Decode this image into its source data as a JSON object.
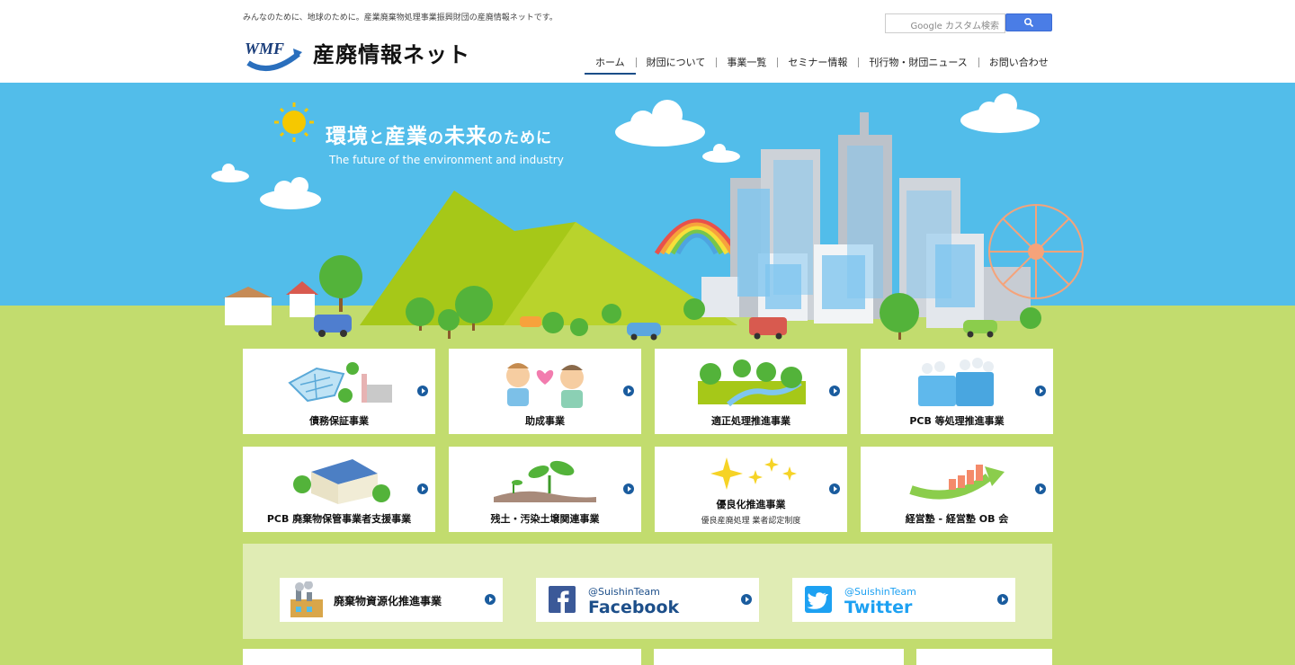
{
  "header": {
    "tagline": "みんなのために、地球のために。産業廃棄物処理事業振興財団の産廃情報ネットです。",
    "logo_mark_text": "WMF",
    "site_name": "産廃情報ネット",
    "search_placeholder": "Google カスタム検索"
  },
  "nav": {
    "items": [
      {
        "label": "ホーム"
      },
      {
        "label": "財団について"
      },
      {
        "label": "事業一覧"
      },
      {
        "label": "セミナー情報"
      },
      {
        "label": "刊行物・財団ニュース"
      },
      {
        "label": "お問い合わせ"
      }
    ]
  },
  "hero": {
    "title_1": "環境",
    "title_2": "と",
    "title_3": "産業",
    "title_4": "の",
    "title_5": "未来",
    "title_6": "のために",
    "subtitle": "The future of the environment and industry"
  },
  "cards": [
    {
      "label": "債務保証事業",
      "icon": "factory-icon"
    },
    {
      "label": "助成事業",
      "icon": "handshake-heart-icon"
    },
    {
      "label": "適正処理推進事業",
      "icon": "forest-river-icon"
    },
    {
      "label": "PCB 等処理推進事業",
      "icon": "pcb-tanks-icon"
    },
    {
      "label": "PCB 廃棄物保管事業者支援事業",
      "icon": "warehouse-icon"
    },
    {
      "label": "残土・汚染土壌関連事業",
      "icon": "sprout-icon"
    },
    {
      "label": "優良化推進事業",
      "sublabel": "優良産廃処理 業者認定制度",
      "icon": "sparkle-icon"
    },
    {
      "label": "経営塾 - 経営塾 OB 会",
      "icon": "growth-arrow-icon"
    }
  ],
  "band": {
    "resource": {
      "label": "廃棄物資源化推進事業"
    },
    "facebook": {
      "handle": "@SuishinTeam",
      "name": "Facebook"
    },
    "twitter": {
      "handle": "@SuishinTeam",
      "name": "Twitter"
    }
  },
  "colors": {
    "sky": "#52bdea",
    "ground": "#c2dc6e",
    "band": "#e0ecb4",
    "nav_active": "#1a4d88",
    "facebook": "#3b5998",
    "twitter": "#1da1f2"
  }
}
